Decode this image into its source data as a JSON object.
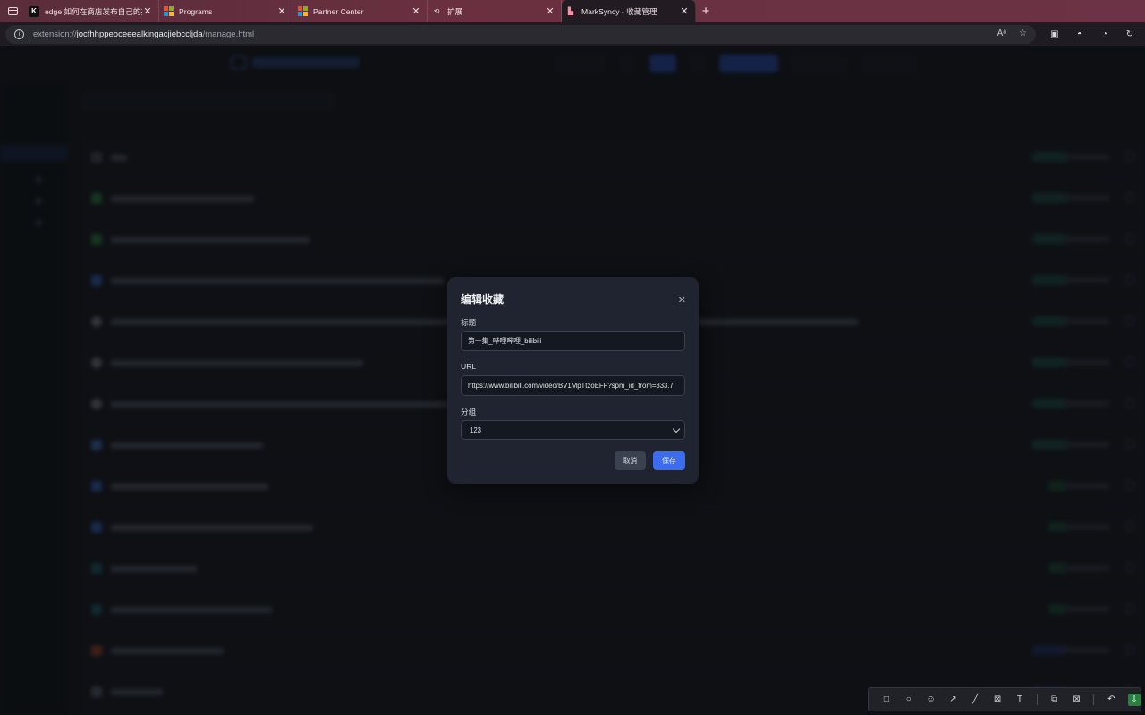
{
  "browser": {
    "tabs": [
      {
        "title": "edge 如何在商店发布自己的拓展",
        "icon": "k-logo-icon",
        "active": false
      },
      {
        "title": "Programs",
        "icon": "microsoft-logo-icon",
        "active": false
      },
      {
        "title": "Partner Center",
        "icon": "microsoft-logo-icon",
        "active": false
      },
      {
        "title": "扩展",
        "icon": "extension-icon",
        "active": false
      },
      {
        "title": "MarkSyncy - 收藏管理",
        "icon": "marksyncy-icon",
        "active": true
      }
    ],
    "close_glyph": "✕",
    "new_tab_glyph": "+",
    "url_prefix": "extension://",
    "url_host": "jocfhhppeoceeealkingacjiebccljda",
    "url_path": "/manage.html"
  },
  "modal": {
    "title": "编辑收藏",
    "close_glyph": "✕",
    "title_label": "标题",
    "title_value": "第一集_哔哩哔哩_bilibili",
    "url_label": "URL",
    "url_value": "https://www.bilibili.com/video/BV1MpTtzoEFF?spm_id_from=333.7",
    "group_label": "分组",
    "group_value": "123",
    "cancel_label": "取消",
    "save_label": "保存"
  },
  "colors": {
    "accent": "#3c6df0",
    "modal_bg": "#1f2430",
    "overlay": "#050609"
  }
}
